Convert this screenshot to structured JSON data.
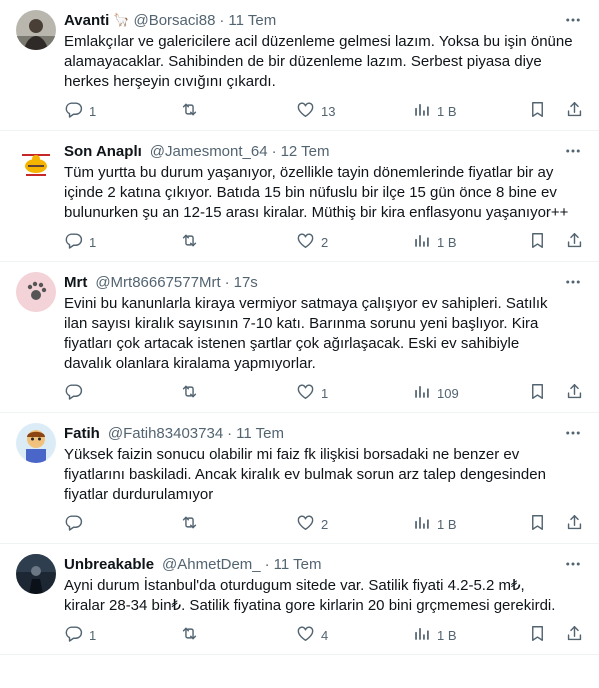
{
  "tweets": [
    {
      "name": "Avanti",
      "badge": "🦙",
      "handle": "@Borsaci88",
      "sep": "·",
      "time": "11 Tem",
      "lines": [
        "Emlakçılar ve galericilere acil düzenleme gelmesi lazım. Yoksa bu işin önüne",
        "alamayacaklar.  Sahibinden de bir düzenleme lazım. Serbest piyasa diye",
        "herkes herşeyin cıvığını çıkardı."
      ],
      "replies": "1",
      "retweets": "",
      "likes": "13",
      "views": "1 B"
    },
    {
      "name": "Son Anaplı",
      "badge": "",
      "handle": "@Jamesmont_64",
      "sep": "·",
      "time": "12 Tem",
      "lines": [
        "Tüm yurtta bu durum yaşanıyor, özellikle tayin dönemlerinde fiyatlar bir ay",
        "içinde 2 katına çıkıyor. Batıda 15 bin nüfuslu bir ilçe 15 gün önce 8 bine ev",
        "bulunurken şu an 12-15 arası kiralar. Müthiş bir kira enflasyonu yaşanıyor++"
      ],
      "replies": "1",
      "retweets": "",
      "likes": "2",
      "views": "1 B"
    },
    {
      "name": "Mrt",
      "badge": "",
      "handle": "@Mrt86667577Mrt",
      "sep": "·",
      "time": "17s",
      "lines": [
        "Evini bu kanunlarla kiraya vermiyor satmaya çalışıyor ev sahipleri. Satılık",
        "ilan sayısı kiralık sayısının 7-10 katı. Barınma sorunu yeni başlıyor. Kira",
        "fiyatları çok artacak istenen şartlar çok ağırlaşacak. Eski ev sahibiyle",
        "davalık olanlara kiralama yapmıyorlar."
      ],
      "replies": "",
      "retweets": "",
      "likes": "1",
      "views": "109"
    },
    {
      "name": "Fatih",
      "badge": "",
      "handle": "@Fatih83403734",
      "sep": "·",
      "time": "11 Tem",
      "lines": [
        "Yüksek faizin sonucu olabilir mi faiz fk ilişkisi borsadaki ne benzer ev",
        "fiyatlarını  baskiladi.  Ancak kiralık ev bulmak sorun arz talep dengesinden",
        "fiyatlar durdurulamıyor"
      ],
      "replies": "",
      "retweets": "",
      "likes": "2",
      "views": "1 B"
    },
    {
      "name": "Unbreakable",
      "badge": "",
      "handle": "@AhmetDem_",
      "sep": "·",
      "time": "11 Tem",
      "lines": [
        "Ayni durum İstanbul'da oturdugum  sitede var. Satilik fiyati 4.2-5.2 m₺,",
        "kiralar 28-34 bin₺. Satilik fiyatina gore kirlarin 20 bini grçmemesi gerekirdi."
      ],
      "replies": "1",
      "retweets": "",
      "likes": "4",
      "views": "1 B"
    }
  ],
  "icons": {
    "reply": "reply-icon",
    "retweet": "retweet-icon",
    "like": "heart-icon",
    "views": "views-icon",
    "bookmark": "bookmark-icon",
    "share": "share-icon",
    "more": "more-icon"
  },
  "colors": {
    "text": "#0f1419",
    "secondary": "#536471",
    "border": "#eff3f4"
  }
}
